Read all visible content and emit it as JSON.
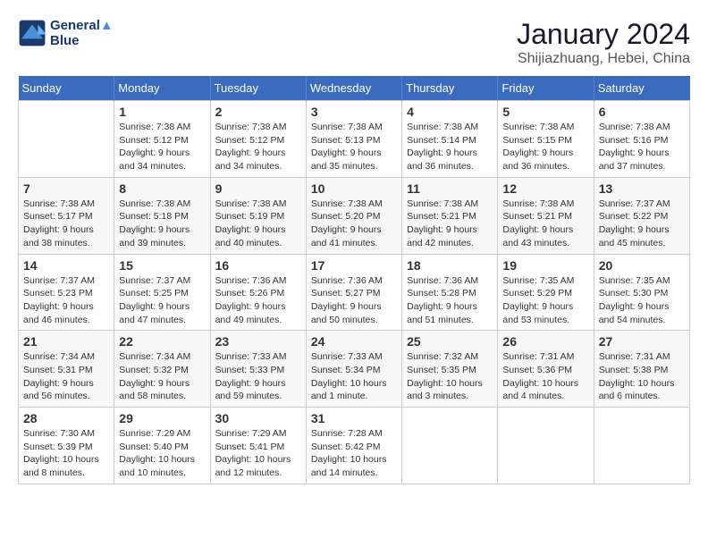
{
  "header": {
    "logo_line1": "General",
    "logo_line2": "Blue",
    "main_title": "January 2024",
    "subtitle": "Shijiazhuang, Hebei, China"
  },
  "days_of_week": [
    "Sunday",
    "Monday",
    "Tuesday",
    "Wednesday",
    "Thursday",
    "Friday",
    "Saturday"
  ],
  "weeks": [
    [
      {
        "day": "",
        "info": ""
      },
      {
        "day": "1",
        "info": "Sunrise: 7:38 AM\nSunset: 5:12 PM\nDaylight: 9 hours\nand 34 minutes."
      },
      {
        "day": "2",
        "info": "Sunrise: 7:38 AM\nSunset: 5:12 PM\nDaylight: 9 hours\nand 34 minutes."
      },
      {
        "day": "3",
        "info": "Sunrise: 7:38 AM\nSunset: 5:13 PM\nDaylight: 9 hours\nand 35 minutes."
      },
      {
        "day": "4",
        "info": "Sunrise: 7:38 AM\nSunset: 5:14 PM\nDaylight: 9 hours\nand 36 minutes."
      },
      {
        "day": "5",
        "info": "Sunrise: 7:38 AM\nSunset: 5:15 PM\nDaylight: 9 hours\nand 36 minutes."
      },
      {
        "day": "6",
        "info": "Sunrise: 7:38 AM\nSunset: 5:16 PM\nDaylight: 9 hours\nand 37 minutes."
      }
    ],
    [
      {
        "day": "7",
        "info": "Sunrise: 7:38 AM\nSunset: 5:17 PM\nDaylight: 9 hours\nand 38 minutes."
      },
      {
        "day": "8",
        "info": "Sunrise: 7:38 AM\nSunset: 5:18 PM\nDaylight: 9 hours\nand 39 minutes."
      },
      {
        "day": "9",
        "info": "Sunrise: 7:38 AM\nSunset: 5:19 PM\nDaylight: 9 hours\nand 40 minutes."
      },
      {
        "day": "10",
        "info": "Sunrise: 7:38 AM\nSunset: 5:20 PM\nDaylight: 9 hours\nand 41 minutes."
      },
      {
        "day": "11",
        "info": "Sunrise: 7:38 AM\nSunset: 5:21 PM\nDaylight: 9 hours\nand 42 minutes."
      },
      {
        "day": "12",
        "info": "Sunrise: 7:38 AM\nSunset: 5:21 PM\nDaylight: 9 hours\nand 43 minutes."
      },
      {
        "day": "13",
        "info": "Sunrise: 7:37 AM\nSunset: 5:22 PM\nDaylight: 9 hours\nand 45 minutes."
      }
    ],
    [
      {
        "day": "14",
        "info": "Sunrise: 7:37 AM\nSunset: 5:23 PM\nDaylight: 9 hours\nand 46 minutes."
      },
      {
        "day": "15",
        "info": "Sunrise: 7:37 AM\nSunset: 5:25 PM\nDaylight: 9 hours\nand 47 minutes."
      },
      {
        "day": "16",
        "info": "Sunrise: 7:36 AM\nSunset: 5:26 PM\nDaylight: 9 hours\nand 49 minutes."
      },
      {
        "day": "17",
        "info": "Sunrise: 7:36 AM\nSunset: 5:27 PM\nDaylight: 9 hours\nand 50 minutes."
      },
      {
        "day": "18",
        "info": "Sunrise: 7:36 AM\nSunset: 5:28 PM\nDaylight: 9 hours\nand 51 minutes."
      },
      {
        "day": "19",
        "info": "Sunrise: 7:35 AM\nSunset: 5:29 PM\nDaylight: 9 hours\nand 53 minutes."
      },
      {
        "day": "20",
        "info": "Sunrise: 7:35 AM\nSunset: 5:30 PM\nDaylight: 9 hours\nand 54 minutes."
      }
    ],
    [
      {
        "day": "21",
        "info": "Sunrise: 7:34 AM\nSunset: 5:31 PM\nDaylight: 9 hours\nand 56 minutes."
      },
      {
        "day": "22",
        "info": "Sunrise: 7:34 AM\nSunset: 5:32 PM\nDaylight: 9 hours\nand 58 minutes."
      },
      {
        "day": "23",
        "info": "Sunrise: 7:33 AM\nSunset: 5:33 PM\nDaylight: 9 hours\nand 59 minutes."
      },
      {
        "day": "24",
        "info": "Sunrise: 7:33 AM\nSunset: 5:34 PM\nDaylight: 10 hours\nand 1 minute."
      },
      {
        "day": "25",
        "info": "Sunrise: 7:32 AM\nSunset: 5:35 PM\nDaylight: 10 hours\nand 3 minutes."
      },
      {
        "day": "26",
        "info": "Sunrise: 7:31 AM\nSunset: 5:36 PM\nDaylight: 10 hours\nand 4 minutes."
      },
      {
        "day": "27",
        "info": "Sunrise: 7:31 AM\nSunset: 5:38 PM\nDaylight: 10 hours\nand 6 minutes."
      }
    ],
    [
      {
        "day": "28",
        "info": "Sunrise: 7:30 AM\nSunset: 5:39 PM\nDaylight: 10 hours\nand 8 minutes."
      },
      {
        "day": "29",
        "info": "Sunrise: 7:29 AM\nSunset: 5:40 PM\nDaylight: 10 hours\nand 10 minutes."
      },
      {
        "day": "30",
        "info": "Sunrise: 7:29 AM\nSunset: 5:41 PM\nDaylight: 10 hours\nand 12 minutes."
      },
      {
        "day": "31",
        "info": "Sunrise: 7:28 AM\nSunset: 5:42 PM\nDaylight: 10 hours\nand 14 minutes."
      },
      {
        "day": "",
        "info": ""
      },
      {
        "day": "",
        "info": ""
      },
      {
        "day": "",
        "info": ""
      }
    ]
  ]
}
